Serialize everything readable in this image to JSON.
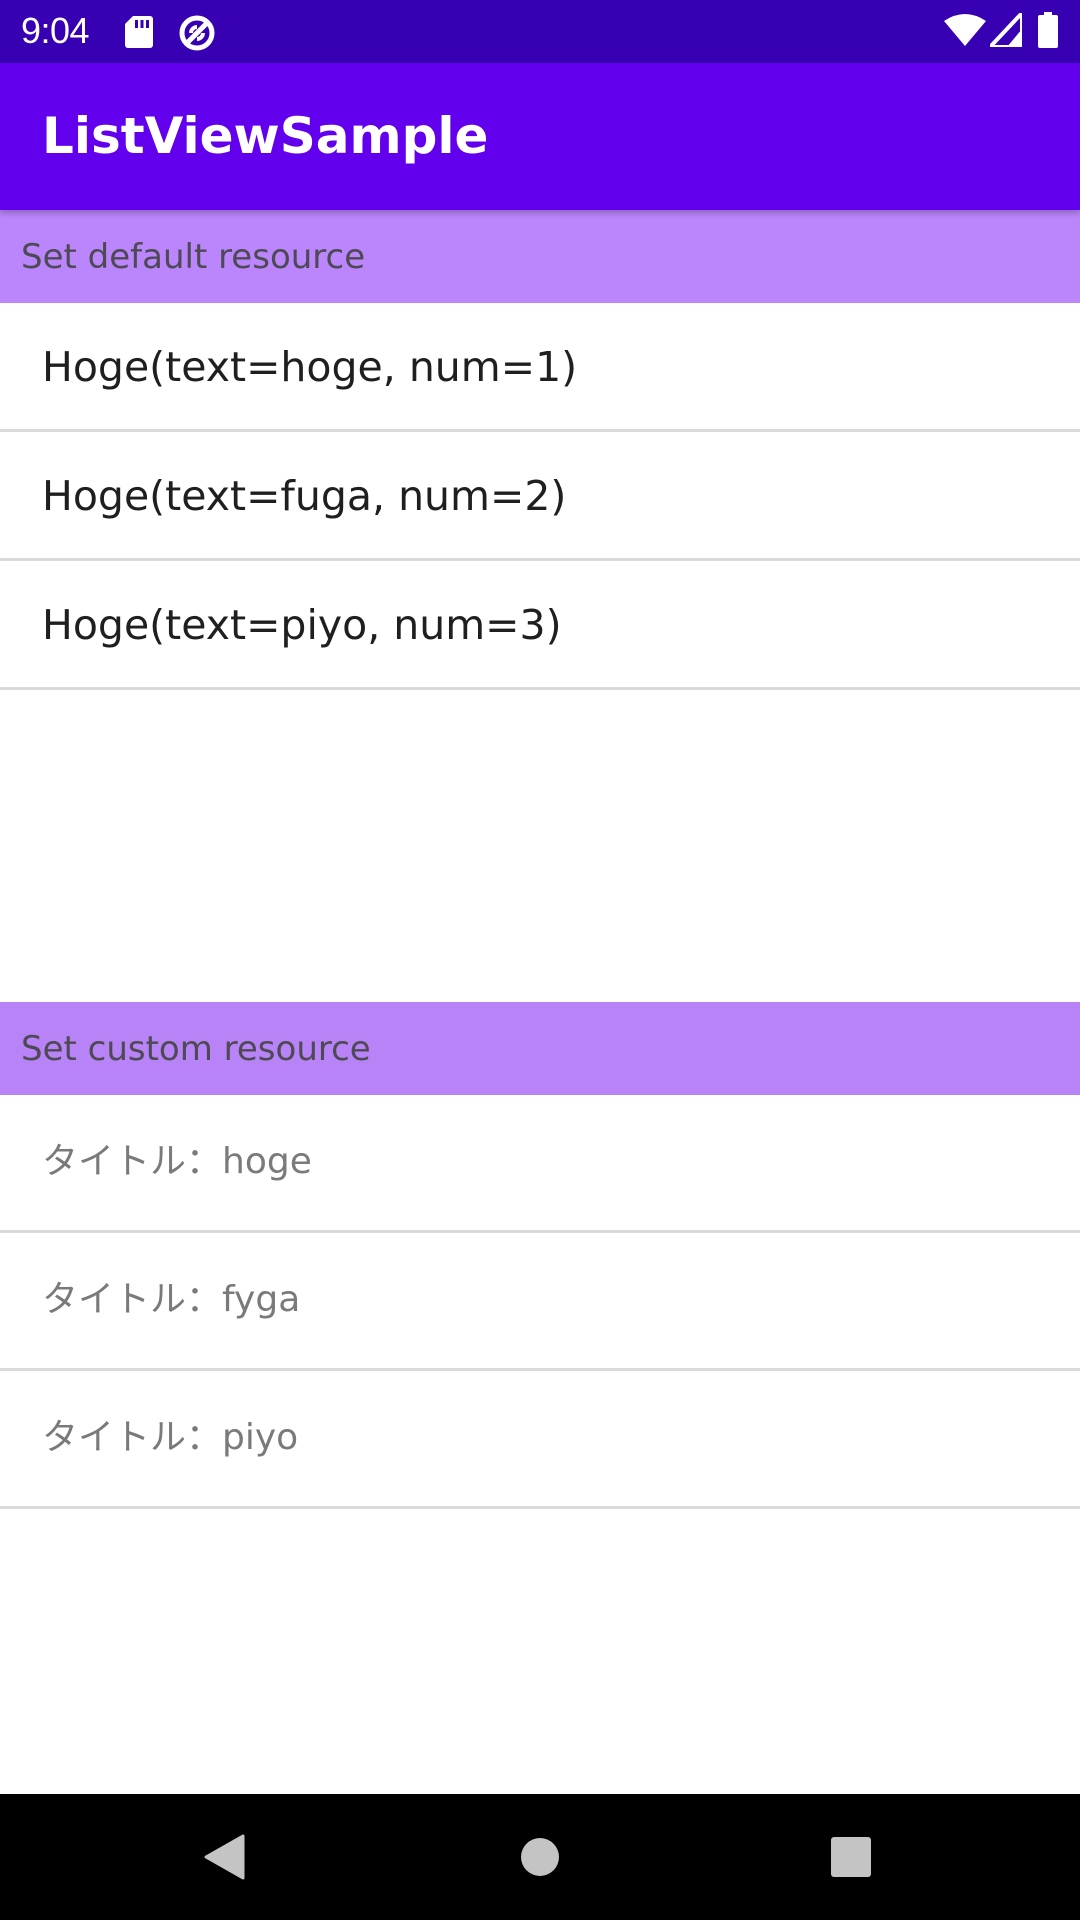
{
  "status_bar": {
    "time": "9:04",
    "icons": [
      "sd-card-icon",
      "sync-icon",
      "wifi-icon",
      "signal-icon",
      "battery-icon"
    ],
    "color": "#3700b3"
  },
  "app_bar": {
    "title": "ListViewSample",
    "color": "#6200ee"
  },
  "sections": [
    {
      "header": "Set default resource",
      "items": [
        "Hoge(text=hoge, num=1)",
        "Hoge(text=fuga, num=2)",
        "Hoge(text=piyo, num=3)"
      ]
    },
    {
      "header": "Set custom resource",
      "items": [
        "タイトル：hoge",
        "タイトル：fyga",
        "タイトル：piyo"
      ]
    }
  ],
  "colors": {
    "section_header": "#bb86fc",
    "divider": "#dadada",
    "nav_bar": "#000000"
  },
  "nav_bar": {
    "buttons": [
      "back-icon",
      "home-icon",
      "recents-icon"
    ]
  }
}
